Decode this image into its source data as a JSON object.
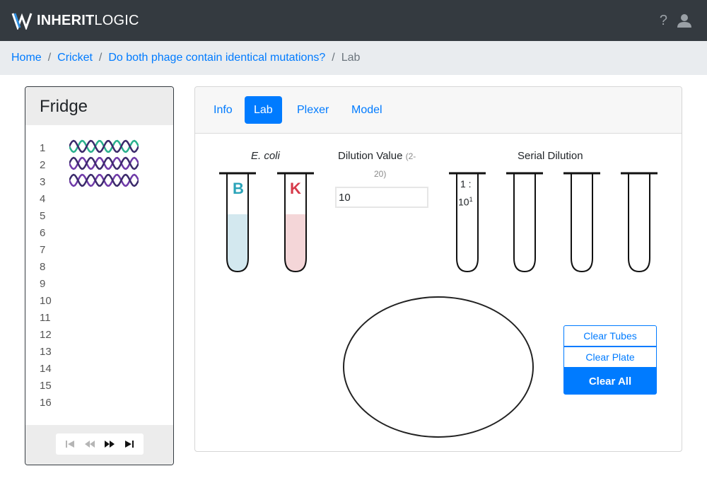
{
  "navbar": {
    "brand_bold": "INHERIT",
    "brand_light": "LOGIC",
    "help_label": "?"
  },
  "breadcrumb": {
    "items": [
      "Home",
      "Cricket",
      "Do both phage contain identical mutations?"
    ],
    "active": "Lab"
  },
  "fridge": {
    "title": "Fridge",
    "slots": [
      "1",
      "2",
      "3",
      "4",
      "5",
      "6",
      "7",
      "8",
      "9",
      "10",
      "11",
      "12",
      "13",
      "14",
      "15",
      "16"
    ],
    "phage_slots": [
      {
        "slot": "1",
        "color": "#2ab08d"
      },
      {
        "slot": "2",
        "color": "#6f3aa8"
      },
      {
        "slot": "3",
        "color": "#6f3aa8"
      }
    ]
  },
  "tabs": [
    "Info",
    "Lab",
    "Plexer",
    "Model"
  ],
  "active_tab": "Lab",
  "lab": {
    "ecoli_label": "E. coli",
    "dilution_label": "Dilution Value",
    "dilution_range_a": "(2-",
    "dilution_range_b": "20)",
    "dilution_value": "10",
    "serial_label": "Serial Dilution",
    "tube_b_letter": "B",
    "tube_k_letter": "K",
    "tube_b_color": "#2aa3b8",
    "tube_k_color": "#d63a4a",
    "ratio_top": "1 :",
    "ratio_base": "10",
    "ratio_exp": "1"
  },
  "buttons": {
    "clear_tubes": "Clear Tubes",
    "clear_plate": "Clear Plate",
    "clear_all": "Clear All"
  }
}
